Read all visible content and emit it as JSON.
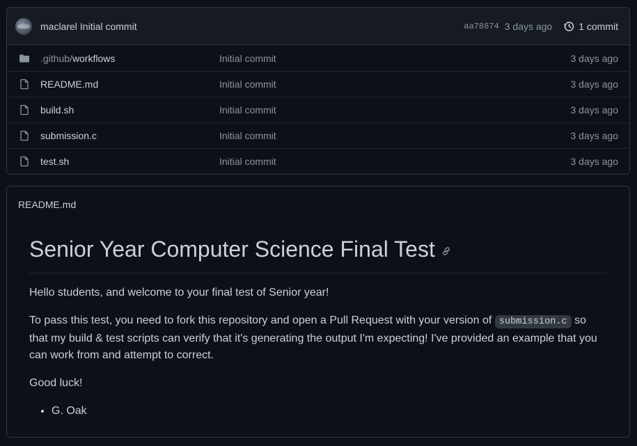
{
  "commit": {
    "author": "maclarel",
    "message": "Initial commit",
    "sha": "aa78674",
    "time_ago": "3 days ago",
    "count_label": "1 commit"
  },
  "files": [
    {
      "type": "folder",
      "name_prefix": ".github/",
      "name": "workflows",
      "message": "Initial commit",
      "time_ago": "3 days ago",
      "icon": "folder-icon"
    },
    {
      "type": "file",
      "name_prefix": "",
      "name": "README.md",
      "message": "Initial commit",
      "time_ago": "3 days ago",
      "icon": "file-icon"
    },
    {
      "type": "file",
      "name_prefix": "",
      "name": "build.sh",
      "message": "Initial commit",
      "time_ago": "3 days ago",
      "icon": "file-icon"
    },
    {
      "type": "file",
      "name_prefix": "",
      "name": "submission.c",
      "message": "Initial commit",
      "time_ago": "3 days ago",
      "icon": "file-icon"
    },
    {
      "type": "file",
      "name_prefix": "",
      "name": "test.sh",
      "message": "Initial commit",
      "time_ago": "3 days ago",
      "icon": "file-icon"
    }
  ],
  "readme": {
    "filename": "README.md",
    "title": "Senior Year Computer Science Final Test",
    "para1": "Hello students, and welcome to your final test of Senior year!",
    "para2_before": "To pass this test, you need to fork this repository and open a Pull Request with your version of ",
    "para2_code": "submission.c",
    "para2_after": " so that my build & test scripts can verify that it's generating the output I'm expecting! I've provided an example that you can work from and attempt to correct.",
    "para3": "Good luck!",
    "list_items": [
      "G. Oak"
    ]
  },
  "colors": {
    "background": "#0d1117",
    "header_bg": "#161b22",
    "border": "#30363d",
    "text": "#c9d1d9",
    "muted": "#8b949e",
    "folder": "#8b949e"
  }
}
